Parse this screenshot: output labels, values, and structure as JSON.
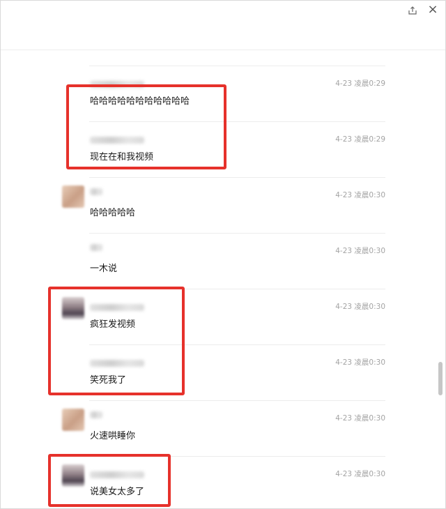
{
  "window": {
    "close_glyph": "×"
  },
  "messages": [
    {
      "time": "4-23 凌晨0:29",
      "text": "哈哈哈哈哈哈哈哈哈哈哈"
    },
    {
      "time": "4-23 凌晨0:29",
      "text": "现在在和我视频"
    },
    {
      "time": "4-23 凌晨0:30",
      "text": "哈哈哈哈哈"
    },
    {
      "time": "4-23 凌晨0:30",
      "text": "一木说"
    },
    {
      "time": "4-23 凌晨0:30",
      "text": "疯狂发视频"
    },
    {
      "time": "4-23 凌晨0:30",
      "text": "笑死我了"
    },
    {
      "time": "4-23 凌晨0:30",
      "text": "火速哄睡你"
    },
    {
      "time": "4-23 凌晨0:30",
      "text": "说美女太多了"
    }
  ],
  "colors": {
    "highlight": "#e6312b",
    "timestamp": "#a3a3a3",
    "message_text": "#1a1a1a",
    "divider": "#ececec"
  }
}
